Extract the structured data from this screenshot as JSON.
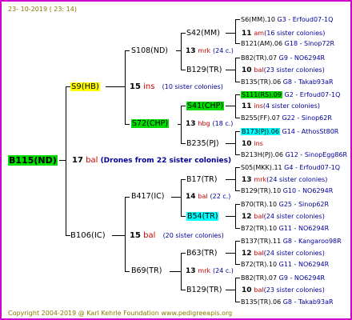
{
  "date_label": "23- 10-2019 ( 23: 14)",
  "copyright": "Copyright 2004-2019 @ Karl Kehrle Foundation   www.pedigreeapis.org",
  "root": {
    "name": "B115(ND)",
    "num": "17",
    "code": "bal",
    "note": "(Drones from 22 sister colonies)"
  },
  "gen1": [
    {
      "name": "S9(HB)",
      "num": "15",
      "code": "ins",
      "note": "(10 sister colonies)"
    },
    {
      "name": "B106(IC)",
      "num": "15",
      "code": "bal",
      "note": "(20 sister colonies)"
    }
  ],
  "gen2": [
    {
      "name": "S108(ND)",
      "num": "13",
      "code": "mrk",
      "note": "(24 c.)"
    },
    {
      "name": "S72(CHP)",
      "num": "13",
      "code": "hbg",
      "note": "(18 c.)"
    },
    {
      "name": "B417(IC)",
      "num": "14",
      "code": "bal",
      "note": "(22 c.)"
    },
    {
      "name": "B69(TR)",
      "num": "13",
      "code": "mrk",
      "note": "(24 c.)"
    }
  ],
  "gen3": [
    {
      "name": "S42(MM)",
      "num": "11",
      "code": "am",
      "note": "(16 sister colonies)"
    },
    {
      "name": "B129(TR)",
      "num": "10",
      "code": "bal",
      "note": "(23 sister colonies)"
    },
    {
      "name": "S41(CHP)",
      "num": "11",
      "code": "ins",
      "note": "(4 sister colonies)"
    },
    {
      "name": "B235(PJ)",
      "num": "10",
      "code": "ins",
      "note": ""
    },
    {
      "name": "B17(TR)",
      "num": "13",
      "code": "mrk",
      "note": "(24 sister colonies)"
    },
    {
      "name": "B54(TR)",
      "num": "12",
      "code": "bal",
      "note": "(24 sister colonies)"
    },
    {
      "name": "B63(TR)",
      "num": "12",
      "code": "bal",
      "note": "(24 sister colonies)"
    },
    {
      "name": "B129(TR)",
      "num": "10",
      "code": "bal",
      "note": "(23 sister colonies)"
    }
  ],
  "gen4": [
    {
      "name": "S6(MM).10",
      "ref": "G3 - Erfoud07-1Q"
    },
    {
      "name": "B121(AM).06",
      "ref": "G18 - Sinop72R"
    },
    {
      "name": "B82(TR).07",
      "ref": "G9 - NO6294R"
    },
    {
      "name": "B135(TR).06",
      "ref": "G8 - Takab93aR"
    },
    {
      "name": "S111(RS).09",
      "ref": "G2 - Erfoud07-1Q"
    },
    {
      "name": "B255(FF).07",
      "ref": "G22 - Sinop62R"
    },
    {
      "name": "B173(PJ).06",
      "ref": "G14 - AthosSt80R"
    },
    {
      "name": "B213H(PJ).06",
      "ref": "G12 - SinopEgg86R"
    },
    {
      "name": "S05(MKK).11",
      "ref": "G4 - Erfoud07-1Q"
    },
    {
      "name": "B129(TR).10",
      "ref": "G10 - NO6294R"
    },
    {
      "name": "B70(TR).10",
      "ref": "G25 - Sinop62R"
    },
    {
      "name": "B72(TR).10",
      "ref": "G11 - NO6294R"
    },
    {
      "name": "B137(TR).11",
      "ref": "G8 - Kangaroo98R"
    },
    {
      "name": "B72(TR).10",
      "ref": "G11 - NO6294R"
    },
    {
      "name": "B82(TR).07",
      "ref": "G9 - NO6294R"
    },
    {
      "name": "B135(TR).06",
      "ref": "G8 - Takab93aR"
    }
  ]
}
